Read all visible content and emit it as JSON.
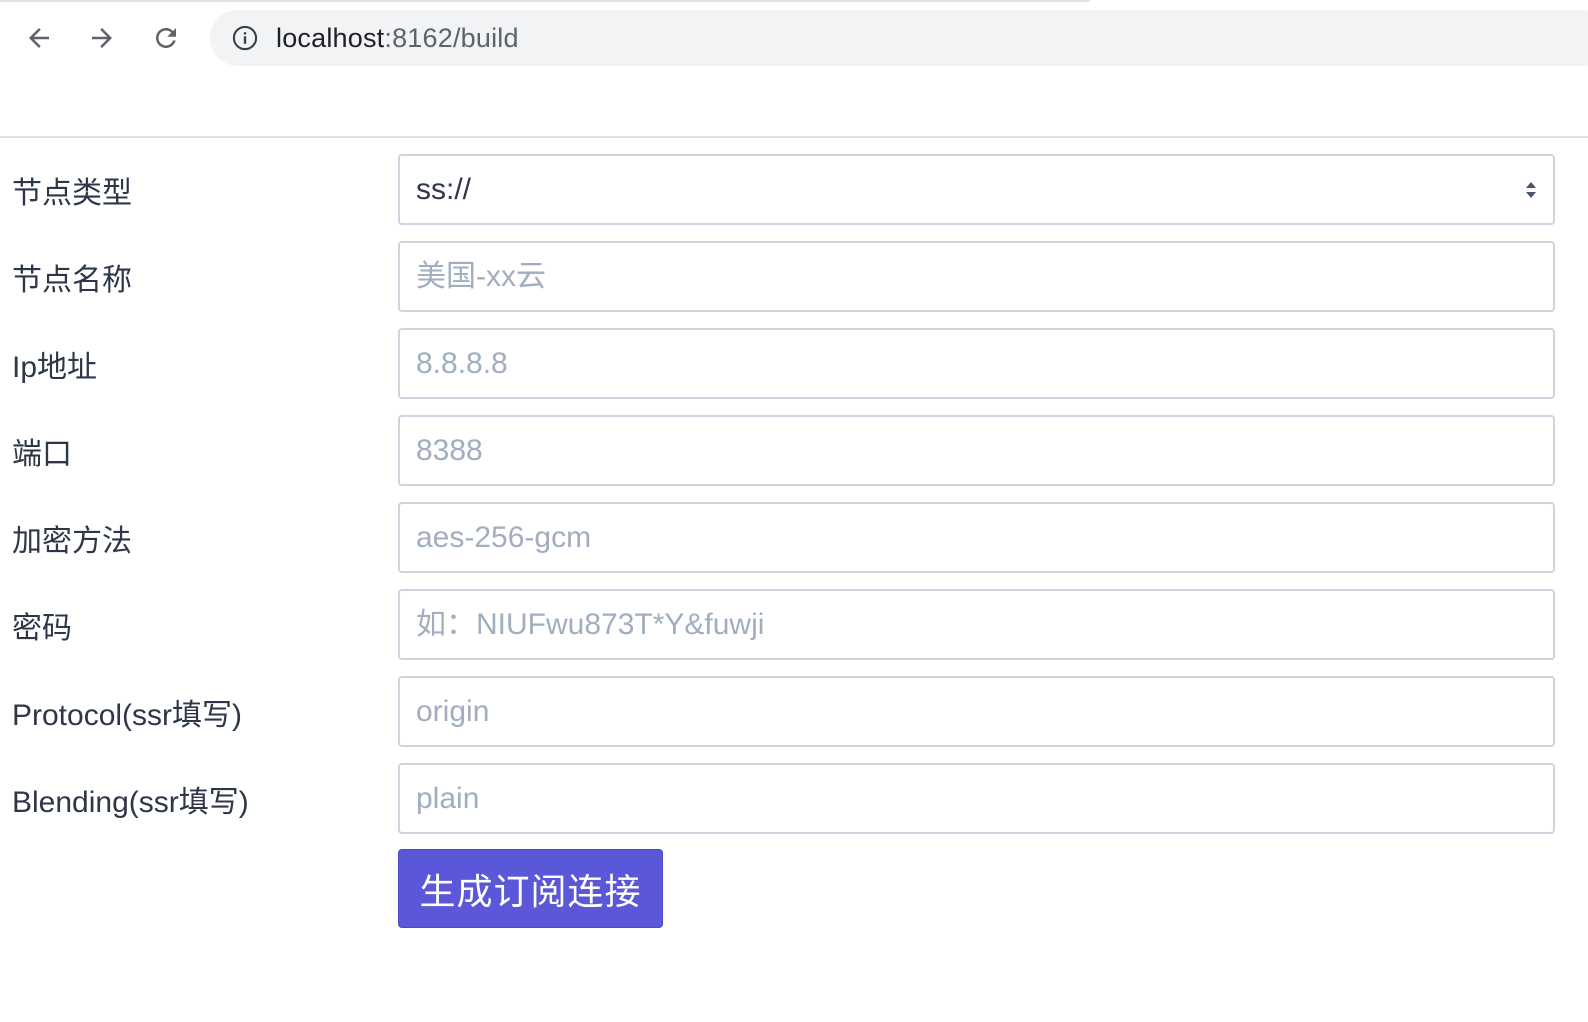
{
  "browser": {
    "url_host": "localhost",
    "url_path": ":8162/build",
    "icons": {
      "back": "arrow-left-icon",
      "forward": "arrow-right-icon",
      "reload": "reload-icon",
      "info": "info-icon"
    }
  },
  "form": {
    "node_type": {
      "label": "节点类型",
      "value": "ss://"
    },
    "node_name": {
      "label": "节点名称",
      "placeholder": "美国-xx云"
    },
    "ip": {
      "label": "Ip地址",
      "placeholder": "8.8.8.8"
    },
    "port": {
      "label": "端口",
      "placeholder": "8388"
    },
    "method": {
      "label": "加密方法",
      "placeholder": "aes-256-gcm"
    },
    "password": {
      "label": "密码",
      "placeholder": "如：NIUFwu873T*Y&fuwji"
    },
    "protocol": {
      "label": "Protocol(ssr填写)",
      "placeholder": "origin"
    },
    "blending": {
      "label": "Blending(ssr填写)",
      "placeholder": "plain"
    },
    "submit_label": "生成订阅连接"
  },
  "colors": {
    "button": "#5a57d9",
    "border": "#cbd5e0",
    "placeholder": "#a0aec0",
    "text": "#2d3748"
  }
}
